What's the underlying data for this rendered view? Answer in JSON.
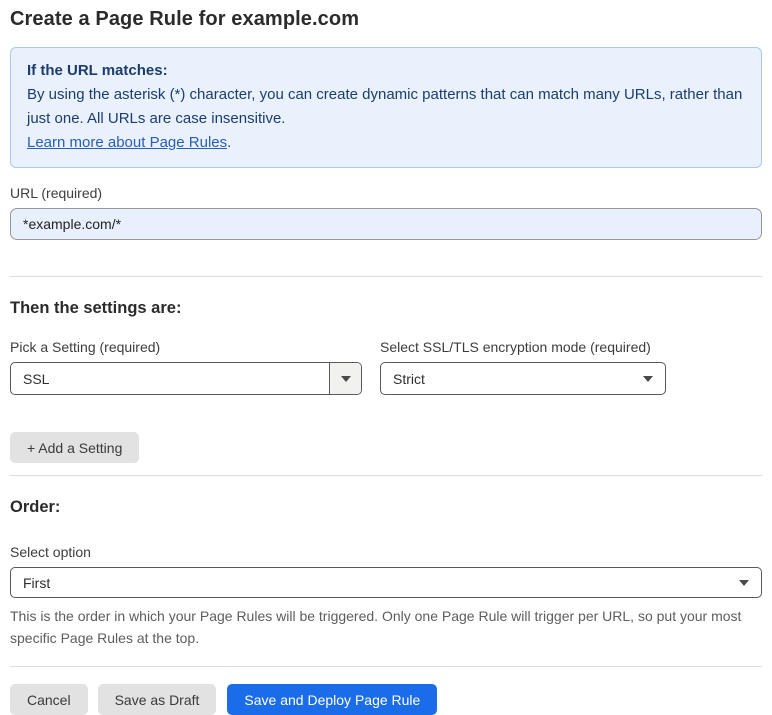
{
  "page": {
    "title": "Create a Page Rule for example.com"
  },
  "info_box": {
    "heading": "If the URL matches:",
    "body": "By using the asterisk (*) character, you can create dynamic patterns that can match many URLs, rather than just one. All URLs are case insensitive.",
    "link_label": "Learn more about Page Rules",
    "link_suffix": "."
  },
  "url_field": {
    "label": "URL (required)",
    "value": "*example.com/*"
  },
  "settings_section": {
    "heading": "Then the settings are:",
    "pick_setting": {
      "label": "Pick a Setting (required)",
      "value": "SSL"
    },
    "ssl_mode": {
      "label": "Select SSL/TLS encryption mode (required)",
      "value": "Strict"
    },
    "add_setting_label": "+ Add a Setting"
  },
  "order_section": {
    "heading": "Order:",
    "select_label": "Select option",
    "value": "First",
    "help_text": "This is the order in which your Page Rules will be triggered. Only one Page Rule will trigger per URL, so put your most specific Page Rules at the top."
  },
  "footer": {
    "cancel_label": "Cancel",
    "save_draft_label": "Save as Draft",
    "save_deploy_label": "Save and Deploy Page Rule"
  },
  "icons": {
    "dropdown_arrow": "caret-down-icon"
  },
  "colors": {
    "info_bg": "#e9f2fc",
    "info_border": "#abc9ea",
    "info_text": "#1d3c6d",
    "link": "#2a5db4",
    "url_input_bg": "#e8f0fe",
    "primary_button": "#1a6ce8",
    "secondary_button": "#e2e2e2",
    "select_border": "#5a5a5a"
  }
}
